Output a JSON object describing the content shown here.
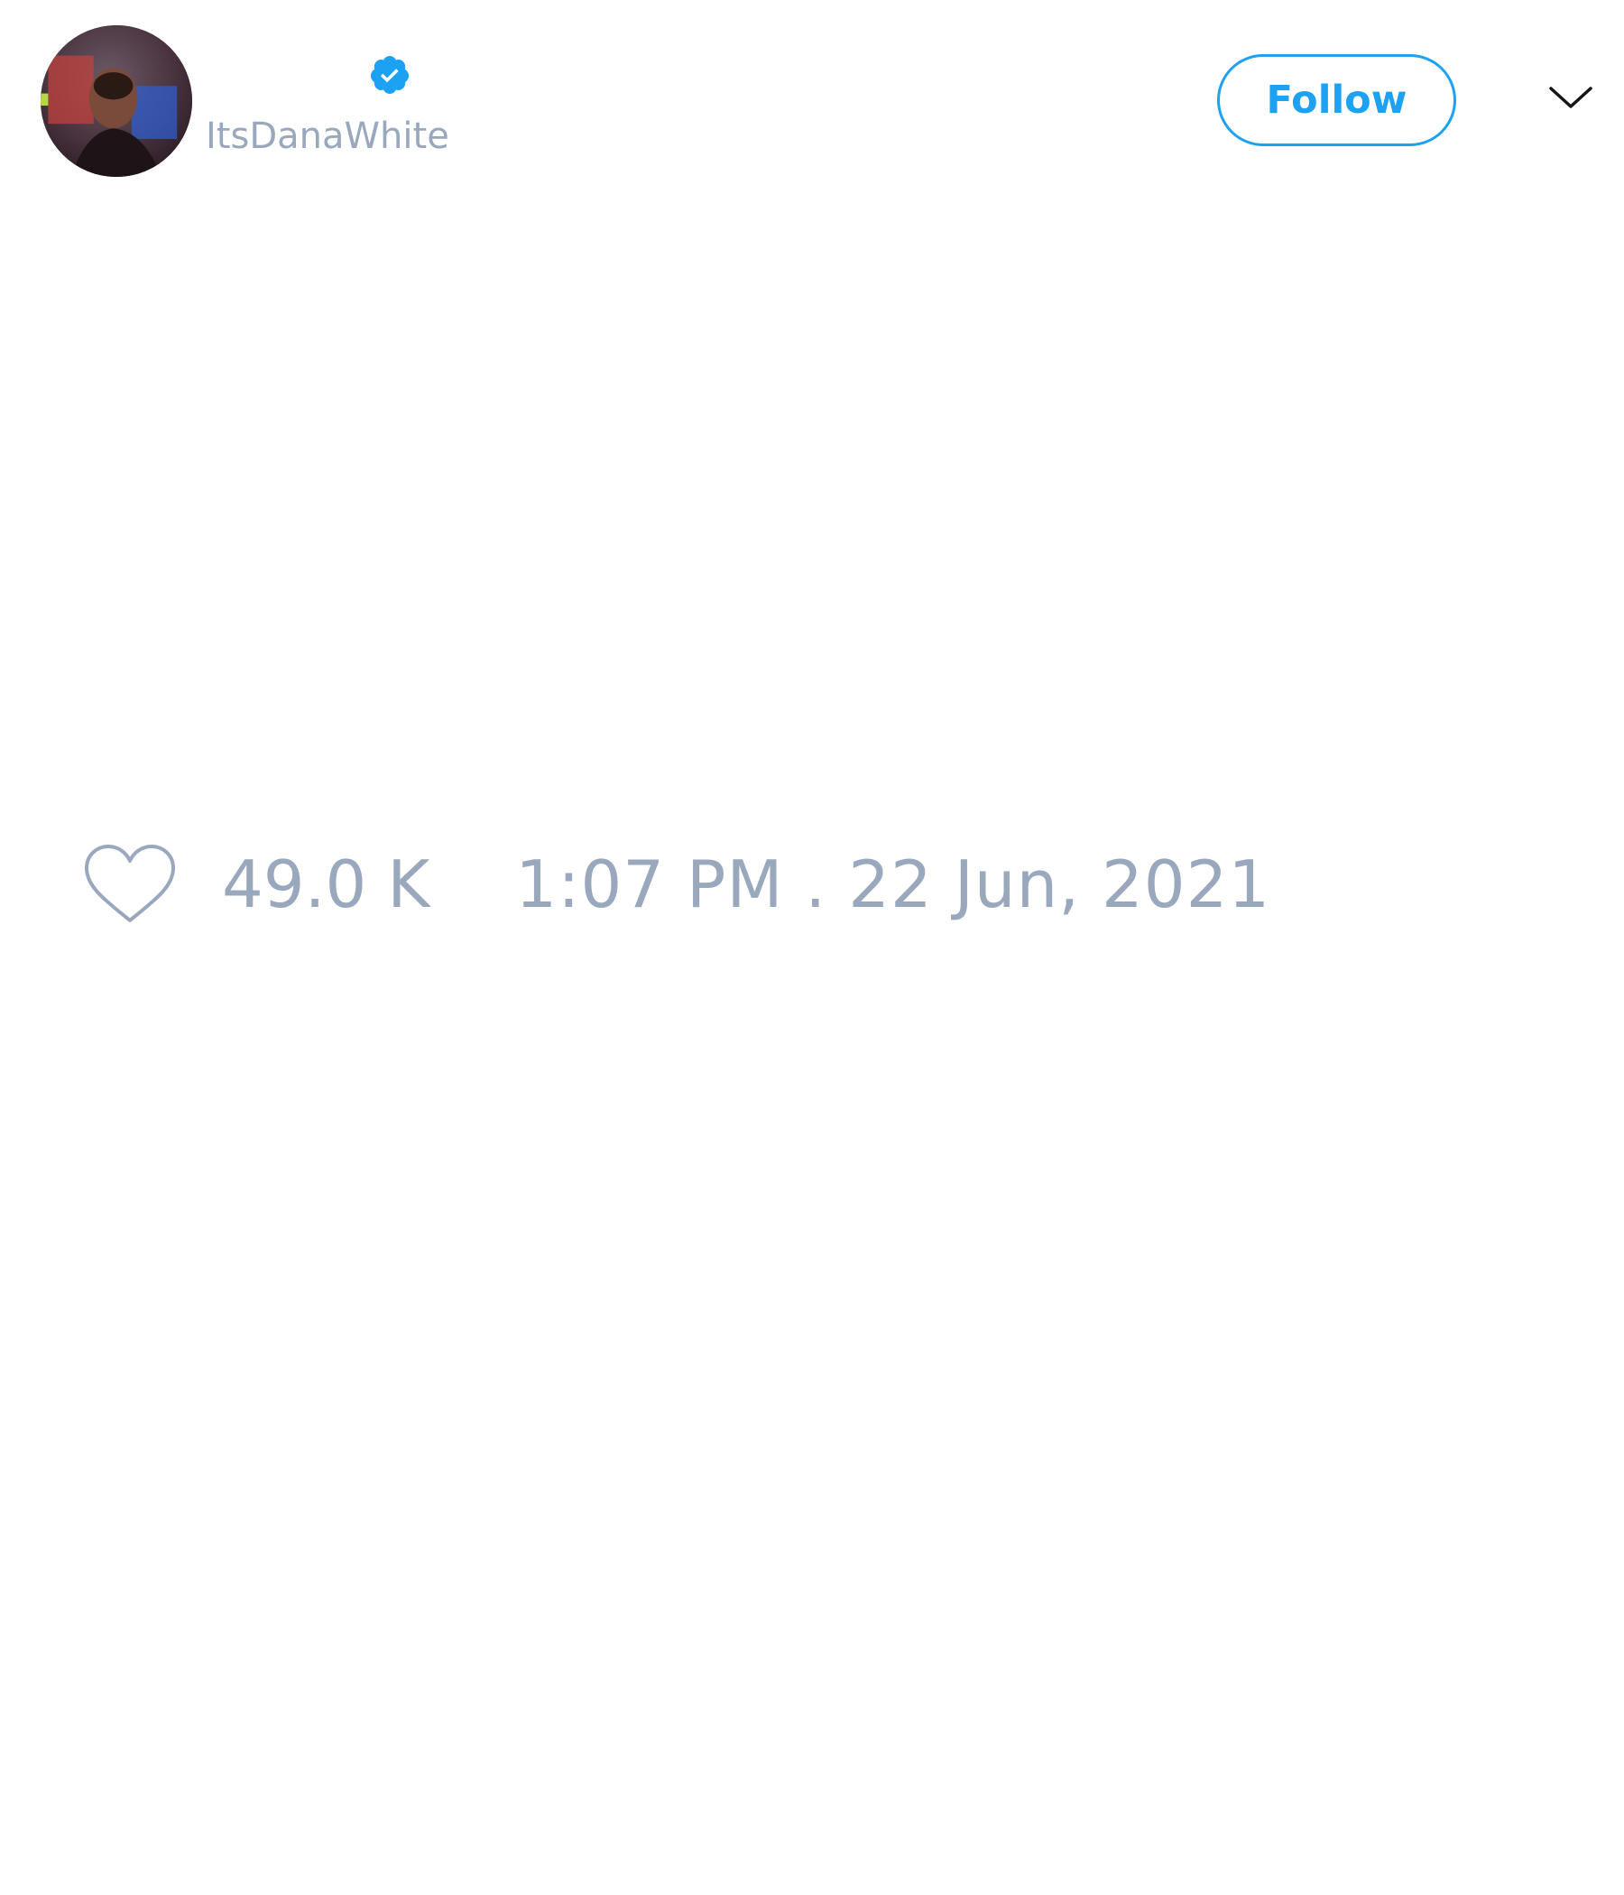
{
  "tweet": {
    "author": {
      "display_name": "",
      "handle": "ItsDanaWhite",
      "verified": true,
      "verified_icon": "verified-badge-icon",
      "avatar": "avatar-photo"
    },
    "follow_label": "Follow",
    "more_icon": "chevron-down-icon",
    "like_icon": "heart-outline-icon",
    "like_count": "49.0 K",
    "timestamp": "1:07 PM . 22 Jun, 2021"
  },
  "colors": {
    "accent": "#1da1f2",
    "muted_text": "#99a8bd",
    "background": "#ffffff"
  }
}
